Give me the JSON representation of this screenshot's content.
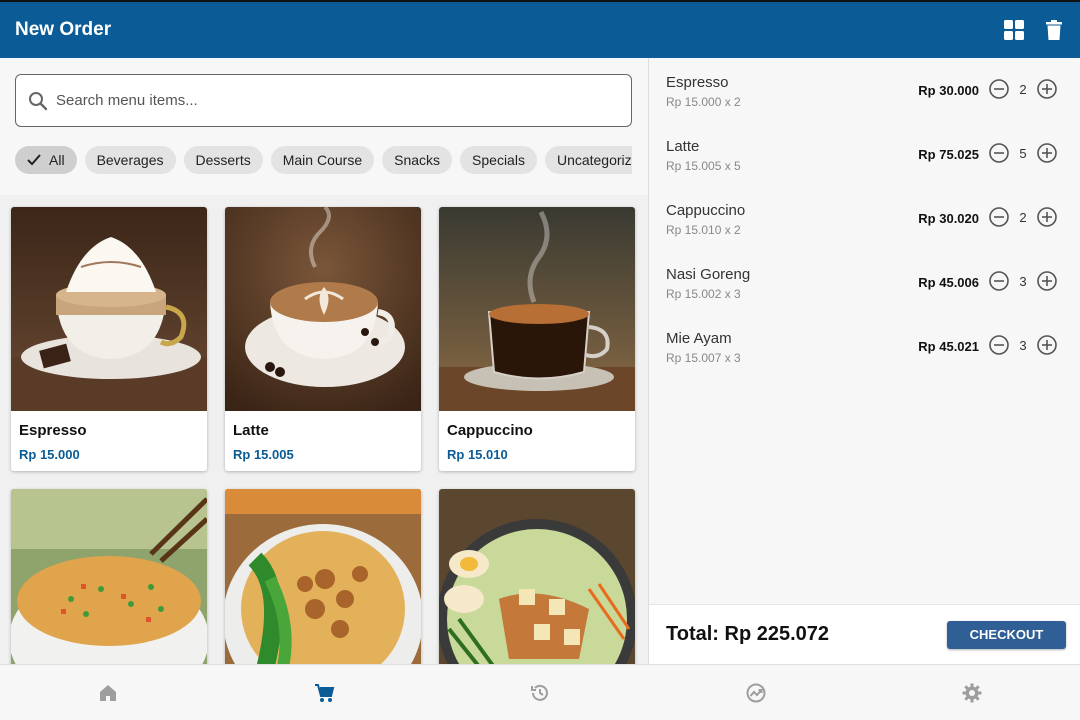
{
  "appbar": {
    "title": "New Order",
    "actions": [
      {
        "icon": "grid-view-icon"
      },
      {
        "icon": "trash-icon"
      }
    ]
  },
  "search": {
    "placeholder": "Search menu items...",
    "value": ""
  },
  "categories": [
    {
      "label": "All",
      "selected": true
    },
    {
      "label": "Beverages",
      "selected": false
    },
    {
      "label": "Desserts",
      "selected": false
    },
    {
      "label": "Main Course",
      "selected": false
    },
    {
      "label": "Snacks",
      "selected": false
    },
    {
      "label": "Specials",
      "selected": false
    },
    {
      "label": "Uncategorized",
      "selected": false
    }
  ],
  "menu_items": [
    {
      "name": "Espresso",
      "price": "Rp 15.000",
      "image": "whipped-coffee-cup"
    },
    {
      "name": "Latte",
      "price": "Rp 15.005",
      "image": "latte-art-cup"
    },
    {
      "name": "Cappuccino",
      "price": "Rp 15.010",
      "image": "black-coffee-glass-cup"
    },
    {
      "name": "",
      "price": "",
      "image": "fried-rice-bowl"
    },
    {
      "name": "",
      "price": "",
      "image": "noodle-bowl"
    },
    {
      "name": "",
      "price": "",
      "image": "gado-gado-plate"
    }
  ],
  "order": {
    "items": [
      {
        "name": "Espresso",
        "detail": "Rp 15.000 x 2",
        "total": "Rp 30.000",
        "qty": "2"
      },
      {
        "name": "Latte",
        "detail": "Rp 15.005 x 5",
        "total": "Rp 75.025",
        "qty": "5"
      },
      {
        "name": "Cappuccino",
        "detail": "Rp 15.010 x 2",
        "total": "Rp 30.020",
        "qty": "2"
      },
      {
        "name": "Nasi Goreng",
        "detail": "Rp 15.002 x 3",
        "total": "Rp 45.006",
        "qty": "3"
      },
      {
        "name": "Mie Ayam",
        "detail": "Rp 15.007 x 3",
        "total": "Rp 45.021",
        "qty": "3"
      }
    ],
    "total": "Total: Rp 225.072",
    "checkout_label": "CHECKOUT"
  },
  "bottom_nav": [
    {
      "icon": "home-icon",
      "active": false
    },
    {
      "icon": "cart-icon",
      "active": true
    },
    {
      "icon": "history-icon",
      "active": false
    },
    {
      "icon": "analytics-icon",
      "active": false
    },
    {
      "icon": "settings-icon",
      "active": false
    }
  ],
  "colors": {
    "primary": "#0a5b96",
    "checkout": "#2f5f94",
    "inactive_icon": "#9e9e9e"
  }
}
